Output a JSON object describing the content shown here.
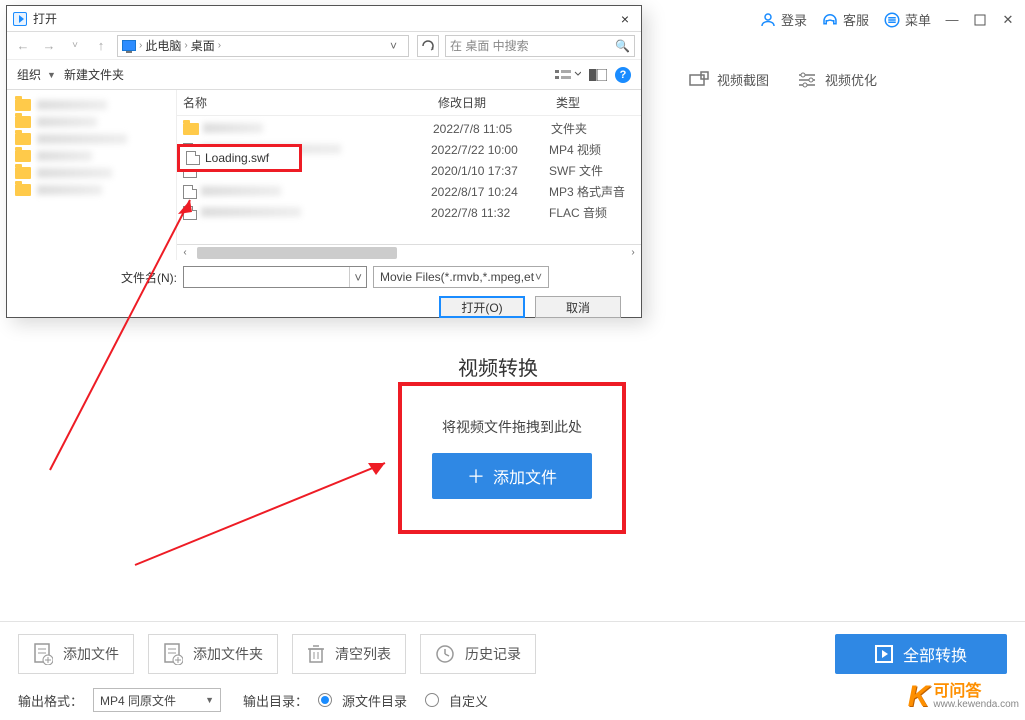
{
  "topbar": {
    "login": "登录",
    "support": "客服",
    "menu": "菜单"
  },
  "righttools": {
    "screenshot": "视频截图",
    "optimize": "视频优化"
  },
  "dialog": {
    "title": "打开",
    "breadcrumb": {
      "pc": "此电脑",
      "desktop": "桌面"
    },
    "search_placeholder": "在 桌面 中搜索",
    "toolbar": {
      "organize": "组织",
      "newfolder": "新建文件夹"
    },
    "headers": {
      "name": "名称",
      "date": "修改日期",
      "type": "类型"
    },
    "rows": [
      {
        "date": "2022/7/8 11:05",
        "type": "文件夹"
      },
      {
        "date": "2022/7/22 10:00",
        "type": "MP4 视频"
      },
      {
        "date": "2020/1/10 17:37",
        "type": "SWF 文件"
      },
      {
        "date": "2022/8/17 10:24",
        "type": "MP3 格式声音"
      },
      {
        "date": "2022/7/8 11:32",
        "type": "FLAC 音频"
      }
    ],
    "selected_file": "Loading.swf",
    "filename_label": "文件名(N):",
    "filter": "Movie Files(*.rmvb,*.mpeg,et",
    "open_btn": "打开(O)",
    "cancel_btn": "取消"
  },
  "center": {
    "heading": "视频转换",
    "drag_hint": "将视频文件拖拽到此处",
    "add_button": "添加文件"
  },
  "bottom": {
    "add_file": "添加文件",
    "add_folder": "添加文件夹",
    "clear_list": "清空列表",
    "history": "历史记录",
    "convert_all": "全部转换",
    "output_format_label": "输出格式：",
    "output_format_value": "MP4 同原文件",
    "output_dir_label": "输出目录：",
    "radio_src": "源文件目录",
    "radio_custom": "自定义"
  },
  "watermark": {
    "brand": "可问答",
    "url": "www.kewenda.com"
  }
}
